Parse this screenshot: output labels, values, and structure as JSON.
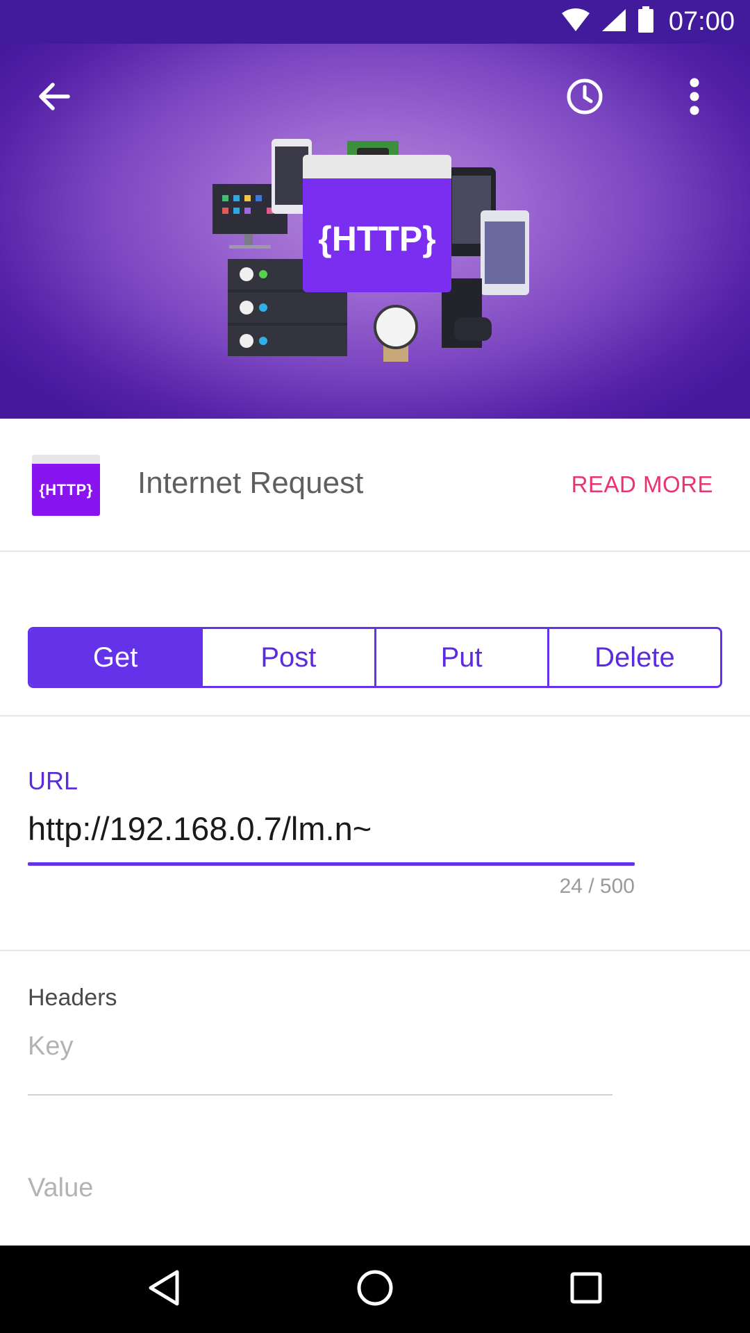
{
  "status_bar": {
    "time": "07:00"
  },
  "hero": {
    "illustration_text": "{HTTP}",
    "back_icon": "arrow-back-icon",
    "history_icon": "history-clock-icon",
    "menu_icon": "more-vert-icon"
  },
  "app": {
    "logo_text": "{HTTP}",
    "name": "Internet Request",
    "read_more": "READ MORE"
  },
  "method_tabs": {
    "selected": "Get",
    "items": [
      "Get",
      "Post",
      "Put",
      "Delete"
    ]
  },
  "url": {
    "label": "URL",
    "value": "http://192.168.0.7/lm.n~",
    "counter": "24 / 500"
  },
  "headers": {
    "label": "Headers",
    "key_placeholder": "Key",
    "value_placeholder": "Value"
  },
  "colors": {
    "accent": "#6432e8",
    "status_bar": "#411b9c",
    "read_more": "#ea3472",
    "logo": "#8a14f0"
  }
}
